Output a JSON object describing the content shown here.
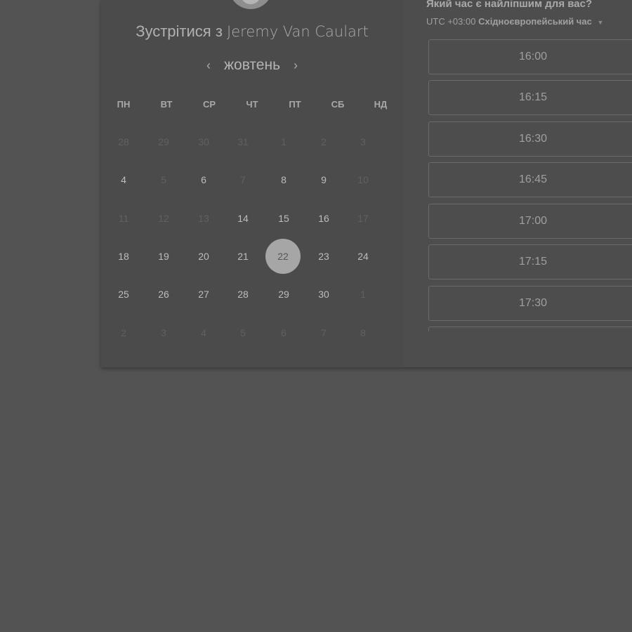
{
  "meeting": {
    "title_prefix": "Зустрітися з",
    "host_name": "Jeremy Van Caulart"
  },
  "calendar": {
    "month_label": "жовтень",
    "prev_icon": "chevron-left-icon",
    "next_icon": "chevron-right-icon",
    "weekdays": [
      "ПН",
      "ВТ",
      "СР",
      "ЧТ",
      "ПТ",
      "СБ",
      "НД"
    ],
    "weeks": [
      [
        {
          "d": "28",
          "s": "muted"
        },
        {
          "d": "29",
          "s": "muted"
        },
        {
          "d": "30",
          "s": "muted"
        },
        {
          "d": "31",
          "s": "muted"
        },
        {
          "d": "1",
          "s": "muted"
        },
        {
          "d": "2",
          "s": "muted"
        },
        {
          "d": "3",
          "s": "muted"
        }
      ],
      [
        {
          "d": "4",
          "s": "avail"
        },
        {
          "d": "5",
          "s": "muted"
        },
        {
          "d": "6",
          "s": "avail"
        },
        {
          "d": "7",
          "s": "muted"
        },
        {
          "d": "8",
          "s": "avail"
        },
        {
          "d": "9",
          "s": "avail"
        },
        {
          "d": "10",
          "s": "muted"
        }
      ],
      [
        {
          "d": "11",
          "s": "muted"
        },
        {
          "d": "12",
          "s": "muted"
        },
        {
          "d": "13",
          "s": "muted"
        },
        {
          "d": "14",
          "s": "avail"
        },
        {
          "d": "15",
          "s": "avail"
        },
        {
          "d": "16",
          "s": "avail"
        },
        {
          "d": "17",
          "s": "muted"
        }
      ],
      [
        {
          "d": "18",
          "s": "avail"
        },
        {
          "d": "19",
          "s": "avail"
        },
        {
          "d": "20",
          "s": "avail"
        },
        {
          "d": "21",
          "s": "avail"
        },
        {
          "d": "22",
          "s": "selected"
        },
        {
          "d": "23",
          "s": "avail"
        },
        {
          "d": "24",
          "s": "avail"
        }
      ],
      [
        {
          "d": "25",
          "s": "avail"
        },
        {
          "d": "26",
          "s": "avail"
        },
        {
          "d": "27",
          "s": "avail"
        },
        {
          "d": "28",
          "s": "avail"
        },
        {
          "d": "29",
          "s": "avail"
        },
        {
          "d": "30",
          "s": "avail"
        },
        {
          "d": "1",
          "s": "muted"
        }
      ],
      [
        {
          "d": "2",
          "s": "muted"
        },
        {
          "d": "3",
          "s": "muted"
        },
        {
          "d": "4",
          "s": "muted"
        },
        {
          "d": "5",
          "s": "muted"
        },
        {
          "d": "6",
          "s": "muted"
        },
        {
          "d": "7",
          "s": "muted"
        },
        {
          "d": "8",
          "s": "muted"
        }
      ]
    ],
    "selected_day": "22"
  },
  "time_panel": {
    "question": "Який час є найліпшим для вас?",
    "timezone_offset": "UTC +03:00",
    "timezone_name": "Східноєвропейський час",
    "dropdown_icon": "caret-down-icon",
    "slots": [
      "16:00",
      "16:15",
      "16:30",
      "16:45",
      "17:00",
      "17:15",
      "17:30",
      ""
    ]
  },
  "colors": {
    "page_bg": "#535353",
    "card_bg": "#4b4b4b",
    "selected_day_bg": "#a6a6a6"
  }
}
